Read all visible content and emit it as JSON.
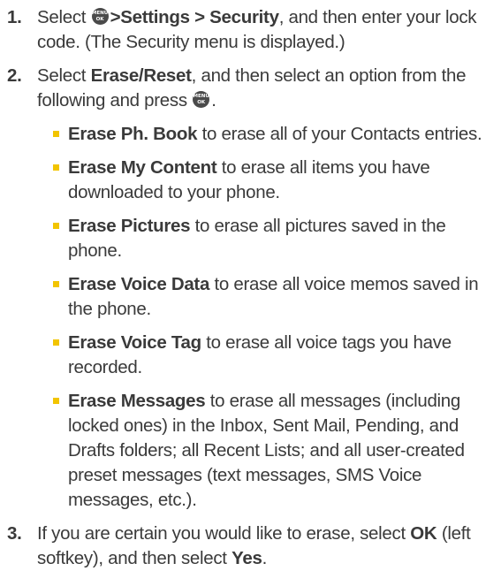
{
  "menu_key": {
    "icon": "menu-ok-key-icon",
    "top": "MENU",
    "bottom": "OK"
  },
  "steps": [
    {
      "number": "1.",
      "path": ">Settings > Security",
      "rest": ", and then enter your lock code. (The Security menu is displayed.)",
      "prefix": "Select "
    },
    {
      "number": "2.",
      "prefix": "Select ",
      "bold": "Erase/Reset",
      "rest": ", and then select an option from the following and press ",
      "end": ".",
      "bullets": [
        {
          "term": "Erase Ph. Book",
          "text": " to erase all of your Contacts entries."
        },
        {
          "term": "Erase My Content",
          "text": " to erase all items you have downloaded to your phone."
        },
        {
          "term": "Erase Pictures",
          "text": " to erase all pictures saved in the phone."
        },
        {
          "term": "Erase Voice Data",
          "text": " to erase all voice memos saved in the phone."
        },
        {
          "term": "Erase Voice Tag",
          "text": "  to erase all voice tags you have recorded."
        },
        {
          "term": "Erase Messages",
          "text": " to erase all messages (including locked ones) in the Inbox, Sent Mail, Pending, and Drafts folders; all Recent Lists; and all user-created preset messages (text messages, SMS Voice messages, etc.)."
        }
      ]
    },
    {
      "number": "3.",
      "prefix": "If you are certain you would like to erase, select ",
      "bold1": "OK",
      "middle": " (left softkey), and then select ",
      "bold2": "Yes",
      "end": "."
    }
  ],
  "colors": {
    "text": "#3a3a3a",
    "bullet": "#f2c400",
    "key": "#4a4a4a"
  }
}
